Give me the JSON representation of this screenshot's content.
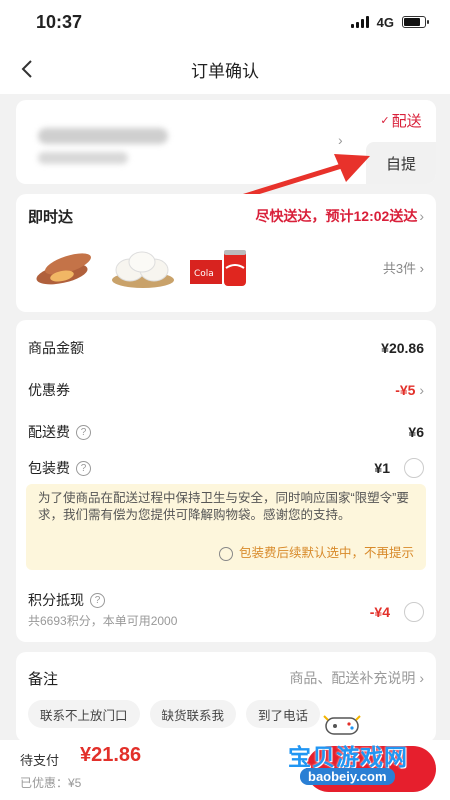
{
  "status_bar": {
    "time": "10:37",
    "network": "4G"
  },
  "nav": {
    "title": "订单确认"
  },
  "address": {
    "delivery_tab": "配送",
    "pickup_tab": "自提"
  },
  "delivery": {
    "label": "即时达",
    "time_text": "尽快送达，预计12:02送达",
    "count": "共3件",
    "products": [
      "sweet-potato",
      "steamed-buns",
      "cola-pack"
    ]
  },
  "fees": {
    "goods_label": "商品金额",
    "goods_value": "¥20.86",
    "coupon_label": "优惠券",
    "coupon_value": "-¥5",
    "shipping_label": "配送费",
    "shipping_value": "¥6",
    "packing_label": "包装费",
    "packing_value": "¥1",
    "notice_text": "为了使商品在配送过程中保持卫生与安全，同时响应国家“限塑令”要求，我们需有偿为您提供可降解购物袋。感谢您的支持。",
    "notice_option": "包装费后续默认选中，不再提示",
    "points_label": "积分抵现",
    "points_value": "-¥4",
    "points_sub": "共6693积分，本单可用2000"
  },
  "remark": {
    "label": "备注",
    "hint": "商品、配送补充说明",
    "chips": [
      "联系不上放门口",
      "缺货联系我",
      "到了电话"
    ]
  },
  "bottom": {
    "pay_label": "待支付",
    "pay_amount": "¥21.86",
    "discount": "已优惠：¥5"
  },
  "watermark": {
    "text": "宝贝游戏网",
    "url": "baobeiy.com"
  },
  "colors": {
    "accent": "#e2302a",
    "notice_bg": "#fdf6dc",
    "watermark": "#2196f3"
  }
}
